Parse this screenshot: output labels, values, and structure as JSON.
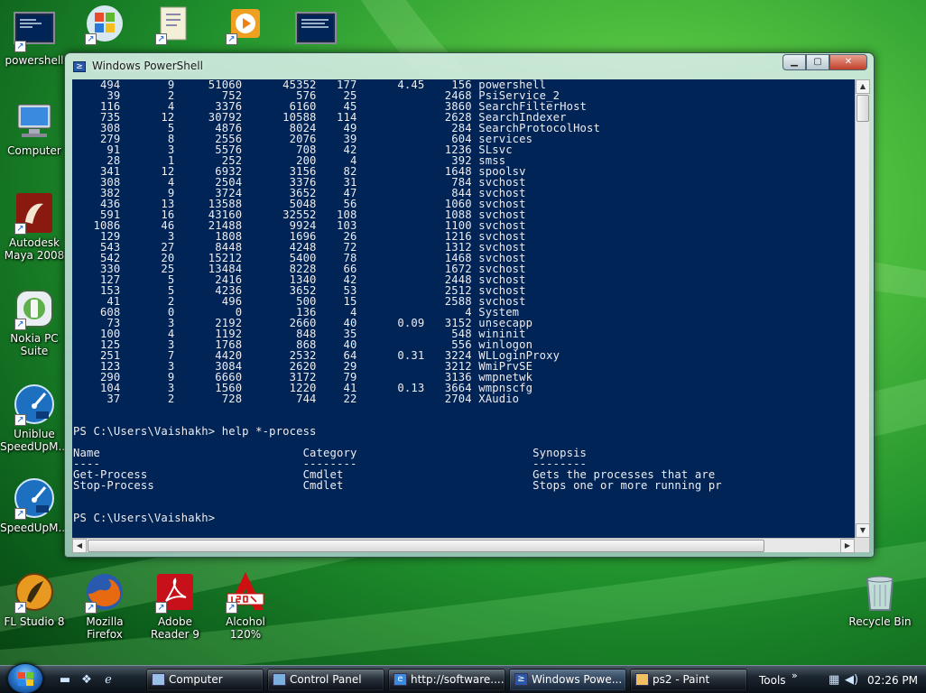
{
  "desktop": {
    "icons_left": [
      {
        "label": "powershell",
        "icon": "powershell-icon"
      },
      {
        "label": "Computer",
        "icon": "computer-icon"
      },
      {
        "label": "Autodesk Maya 2008",
        "icon": "maya-icon"
      },
      {
        "label": "Nokia PC Suite",
        "icon": "nokia-icon"
      },
      {
        "label": "Uniblue SpeedUpM...",
        "icon": "speedometer-icon"
      },
      {
        "label": "SpeedUpM...",
        "icon": "speedometer-icon"
      }
    ],
    "icons_bottom": [
      {
        "label": "FL Studio 8",
        "icon": "fl-studio-icon"
      },
      {
        "label": "Mozilla Firefox",
        "icon": "firefox-icon"
      },
      {
        "label": "Adobe Reader 9",
        "icon": "adobe-reader-icon"
      },
      {
        "label": "Alcohol 120%",
        "icon": "alcohol-icon"
      }
    ],
    "recycle_bin": {
      "label": "Recycle Bin",
      "icon": "recycle-bin-icon"
    }
  },
  "window": {
    "title": "Windows PowerShell",
    "console_text": "    494       9     51060      45352   177      4.45    156 powershell\n     39       2       752        576    25             2468 PsiService_2\n    116       4      3376       6160    45             3860 SearchFilterHost\n    735      12     30792      10588   114             2628 SearchIndexer\n    308       5      4876       8024    49              284 SearchProtocolHost\n    279       8      2556       2076    39              604 services\n     91       3      5576        708    42             1236 SLsvc\n     28       1       252        200     4              392 smss\n    341      12      6932       3156    82             1648 spoolsv\n    308       4      2504       3376    31              784 svchost\n    382       9      3724       3652    47              844 svchost\n    436      13     13588       5048    56             1060 svchost\n    591      16     43160      32552   108             1088 svchost\n   1086      46     21488       9924   103             1100 svchost\n    129       3      1808       1696    26             1216 svchost\n    543      27      8448       4248    72             1312 svchost\n    542      20     15212       5400    78             1468 svchost\n    330      25     13484       8228    66             1672 svchost\n    127       5      2416       1340    42             2448 svchost\n    153       5      4236       3652    53             2512 svchost\n     41       2       496        500    15             2588 svchost\n    608       0         0        136     4                4 System\n     73       3      2192       2660    40      0.09   3152 unsecapp\n    100       4      1192        848    35              548 wininit\n    125       3      1768        868    40              556 winlogon\n    251       7      4420       2532    64      0.31   3224 WLLoginProxy\n    123       3      3084       2620    29             3212 WmiPrvSE\n    290       9      6660       3172    79             3136 wmpnetwk\n    104       3      1560       1220    41      0.13   3664 wmpnscfg\n     37       2       728        744    22             2704 XAudio\n\n\nPS C:\\Users\\Vaishakh> help *-process\n\nName                              Category                          Synopsis\n----                              --------                          --------\nGet-Process                       Cmdlet                            Gets the processes that are\nStop-Process                      Cmdlet                            Stops one or more running pr\n\n\nPS C:\\Users\\Vaishakh>"
  },
  "taskbar": {
    "items": [
      {
        "label": "Computer",
        "icon": "computer-icon",
        "active": false
      },
      {
        "label": "Control Panel",
        "icon": "control-panel-icon",
        "active": false
      },
      {
        "label": "http://software....",
        "icon": "ie-icon",
        "active": false
      },
      {
        "label": "Windows Powe...",
        "icon": "powershell-icon",
        "active": true
      },
      {
        "label": "ps2 - Paint",
        "icon": "paint-icon",
        "active": false
      }
    ],
    "toolbar_label": "Tools",
    "chevron": "»",
    "clock": "02:26 PM"
  },
  "colors": {
    "console_bg": "#012456",
    "console_fg": "#eeedf0"
  }
}
